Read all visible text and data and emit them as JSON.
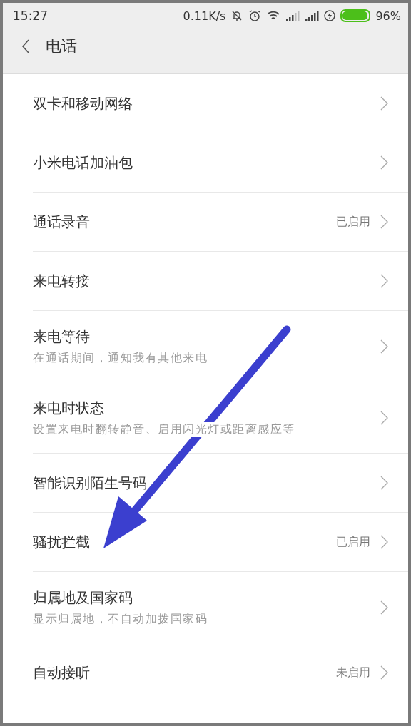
{
  "status_bar": {
    "time": "15:27",
    "speed": "0.11K/s",
    "battery_text": "96%"
  },
  "header": {
    "title": "电话"
  },
  "items": [
    {
      "title": "双卡和移动网络"
    },
    {
      "title": "小米电话加油包"
    },
    {
      "title": "通话录音",
      "value": "已启用"
    },
    {
      "title": "来电转接"
    },
    {
      "title": "来电等待",
      "subtitle": "在通话期间，通知我有其他来电"
    },
    {
      "title": "来电时状态",
      "subtitle": "设置来电时翻转静音、启用闪光灯或距离感应等"
    },
    {
      "title": "智能识别陌生号码"
    },
    {
      "title": "骚扰拦截",
      "value": "已启用"
    },
    {
      "title": "归属地及国家码",
      "subtitle": "显示归属地，不自动加拨国家码"
    },
    {
      "title": "自动接听",
      "value": "未启用"
    }
  ]
}
